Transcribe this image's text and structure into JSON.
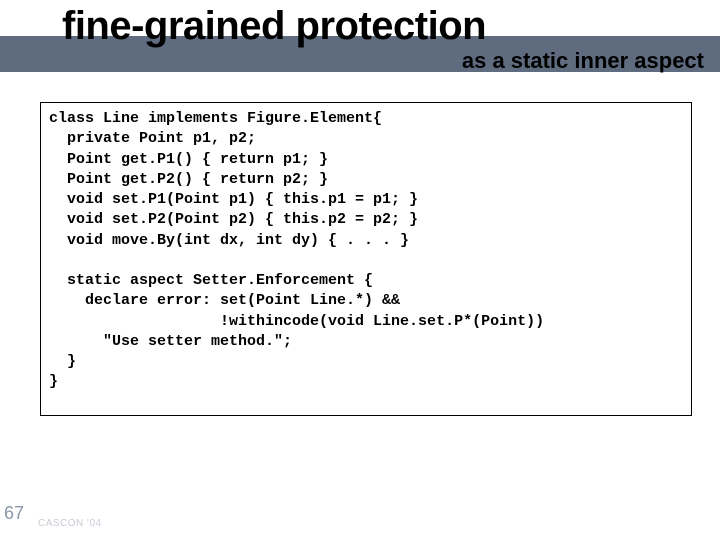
{
  "title": "fine-grained protection",
  "subtitle": "as a static inner aspect",
  "code_lines": [
    "class Line implements Figure.Element{",
    "  private Point p1, p2;",
    "  Point get.P1() { return p1; }",
    "  Point get.P2() { return p2; }",
    "  void set.P1(Point p1) { this.p1 = p1; }",
    "  void set.P2(Point p2) { this.p2 = p2; }",
    "  void move.By(int dx, int dy) { . . . }",
    "",
    "  static aspect Setter.Enforcement {",
    "    declare error: set(Point Line.*) &&",
    "                   !withincode(void Line.set.P*(Point))",
    "      \"Use setter method.\";",
    "  }",
    "}"
  ],
  "slide_number": "67",
  "footer": "CASCON '04"
}
